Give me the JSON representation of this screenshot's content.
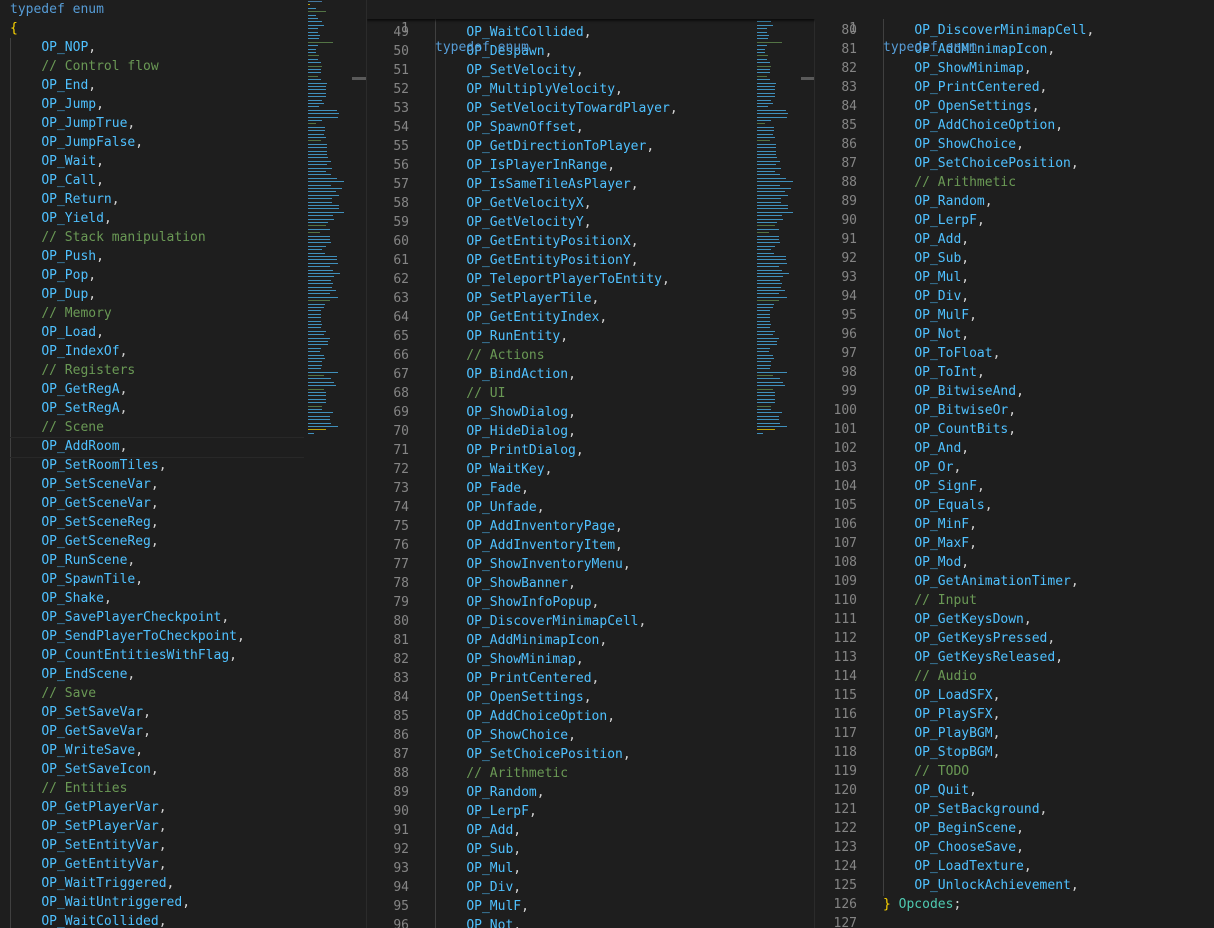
{
  "colors": {
    "keyword": "#569cd6",
    "comment": "#6a9955",
    "constant": "#4fc1ff",
    "brace": "#ffd700",
    "type": "#4ec9b0",
    "background": "#1e1e1e"
  },
  "pane1": {
    "lines": [
      [
        {
          "t": "typedef enum",
          "c": "key"
        }
      ],
      [
        {
          "t": "{",
          "c": "brace"
        }
      ],
      [
        {
          "t": "    "
        },
        {
          "t": "OP_NOP",
          "c": "const"
        },
        {
          "t": ",",
          "c": "punc"
        }
      ],
      [
        {
          "t": "    "
        },
        {
          "t": "// Control flow",
          "c": "cmt"
        }
      ],
      [
        {
          "t": "    "
        },
        {
          "t": "OP_End",
          "c": "const"
        },
        {
          "t": ",",
          "c": "punc"
        }
      ],
      [
        {
          "t": "    "
        },
        {
          "t": "OP_Jump",
          "c": "const"
        },
        {
          "t": ",",
          "c": "punc"
        }
      ],
      [
        {
          "t": "    "
        },
        {
          "t": "OP_JumpTrue",
          "c": "const"
        },
        {
          "t": ",",
          "c": "punc"
        }
      ],
      [
        {
          "t": "    "
        },
        {
          "t": "OP_JumpFalse",
          "c": "const"
        },
        {
          "t": ",",
          "c": "punc"
        }
      ],
      [
        {
          "t": "    "
        },
        {
          "t": "OP_Wait",
          "c": "const"
        },
        {
          "t": ",",
          "c": "punc"
        }
      ],
      [
        {
          "t": "    "
        },
        {
          "t": "OP_Call",
          "c": "const"
        },
        {
          "t": ",",
          "c": "punc"
        }
      ],
      [
        {
          "t": "    "
        },
        {
          "t": "OP_Return",
          "c": "const"
        },
        {
          "t": ",",
          "c": "punc"
        }
      ],
      [
        {
          "t": "    "
        },
        {
          "t": "OP_Yield",
          "c": "const"
        },
        {
          "t": ",",
          "c": "punc"
        }
      ],
      [
        {
          "t": "    "
        },
        {
          "t": "// Stack manipulation",
          "c": "cmt"
        }
      ],
      [
        {
          "t": "    "
        },
        {
          "t": "OP_Push",
          "c": "const"
        },
        {
          "t": ",",
          "c": "punc"
        }
      ],
      [
        {
          "t": "    "
        },
        {
          "t": "OP_Pop",
          "c": "const"
        },
        {
          "t": ",",
          "c": "punc"
        }
      ],
      [
        {
          "t": "    "
        },
        {
          "t": "OP_Dup",
          "c": "const"
        },
        {
          "t": ",",
          "c": "punc"
        }
      ],
      [
        {
          "t": "    "
        },
        {
          "t": "// Memory",
          "c": "cmt"
        }
      ],
      [
        {
          "t": "    "
        },
        {
          "t": "OP_Load",
          "c": "const"
        },
        {
          "t": ",",
          "c": "punc"
        }
      ],
      [
        {
          "t": "    "
        },
        {
          "t": "OP_IndexOf",
          "c": "const"
        },
        {
          "t": ",",
          "c": "punc"
        }
      ],
      [
        {
          "t": "    "
        },
        {
          "t": "// Registers",
          "c": "cmt"
        }
      ],
      [
        {
          "t": "    "
        },
        {
          "t": "OP_GetRegA",
          "c": "const"
        },
        {
          "t": ",",
          "c": "punc"
        }
      ],
      [
        {
          "t": "    "
        },
        {
          "t": "OP_SetRegA",
          "c": "const"
        },
        {
          "t": ",",
          "c": "punc"
        }
      ],
      [
        {
          "t": "    "
        },
        {
          "t": "// Scene",
          "c": "cmt"
        }
      ],
      [
        {
          "t": "    "
        },
        {
          "t": "OP_AddRoom",
          "c": "const"
        },
        {
          "t": ",",
          "c": "punc"
        }
      ],
      [
        {
          "t": "    "
        },
        {
          "t": "OP_SetRoomTiles",
          "c": "const"
        },
        {
          "t": ",",
          "c": "punc"
        }
      ],
      [
        {
          "t": "    "
        },
        {
          "t": "OP_SetSceneVar",
          "c": "const"
        },
        {
          "t": ",",
          "c": "punc"
        }
      ],
      [
        {
          "t": "    "
        },
        {
          "t": "OP_GetSceneVar",
          "c": "const"
        },
        {
          "t": ",",
          "c": "punc"
        }
      ],
      [
        {
          "t": "    "
        },
        {
          "t": "OP_SetSceneReg",
          "c": "const"
        },
        {
          "t": ",",
          "c": "punc"
        }
      ],
      [
        {
          "t": "    "
        },
        {
          "t": "OP_GetSceneReg",
          "c": "const"
        },
        {
          "t": ",",
          "c": "punc"
        }
      ],
      [
        {
          "t": "    "
        },
        {
          "t": "OP_RunScene",
          "c": "const"
        },
        {
          "t": ",",
          "c": "punc"
        }
      ],
      [
        {
          "t": "    "
        },
        {
          "t": "OP_SpawnTile",
          "c": "const"
        },
        {
          "t": ",",
          "c": "punc"
        }
      ],
      [
        {
          "t": "    "
        },
        {
          "t": "OP_Shake",
          "c": "const"
        },
        {
          "t": ",",
          "c": "punc"
        }
      ],
      [
        {
          "t": "    "
        },
        {
          "t": "OP_SavePlayerCheckpoint",
          "c": "const"
        },
        {
          "t": ",",
          "c": "punc"
        }
      ],
      [
        {
          "t": "    "
        },
        {
          "t": "OP_SendPlayerToCheckpoint",
          "c": "const"
        },
        {
          "t": ",",
          "c": "punc"
        }
      ],
      [
        {
          "t": "    "
        },
        {
          "t": "OP_CountEntitiesWithFlag",
          "c": "const"
        },
        {
          "t": ",",
          "c": "punc"
        }
      ],
      [
        {
          "t": "    "
        },
        {
          "t": "OP_EndScene",
          "c": "const"
        },
        {
          "t": ",",
          "c": "punc"
        }
      ],
      [
        {
          "t": "    "
        },
        {
          "t": "// Save",
          "c": "cmt"
        }
      ],
      [
        {
          "t": "    "
        },
        {
          "t": "OP_SetSaveVar",
          "c": "const"
        },
        {
          "t": ",",
          "c": "punc"
        }
      ],
      [
        {
          "t": "    "
        },
        {
          "t": "OP_GetSaveVar",
          "c": "const"
        },
        {
          "t": ",",
          "c": "punc"
        }
      ],
      [
        {
          "t": "    "
        },
        {
          "t": "OP_WriteSave",
          "c": "const"
        },
        {
          "t": ",",
          "c": "punc"
        }
      ],
      [
        {
          "t": "    "
        },
        {
          "t": "OP_SetSaveIcon",
          "c": "const"
        },
        {
          "t": ",",
          "c": "punc"
        }
      ],
      [
        {
          "t": "    "
        },
        {
          "t": "// Entities",
          "c": "cmt"
        }
      ],
      [
        {
          "t": "    "
        },
        {
          "t": "OP_GetPlayerVar",
          "c": "const"
        },
        {
          "t": ",",
          "c": "punc"
        }
      ],
      [
        {
          "t": "    "
        },
        {
          "t": "OP_SetPlayerVar",
          "c": "const"
        },
        {
          "t": ",",
          "c": "punc"
        }
      ],
      [
        {
          "t": "    "
        },
        {
          "t": "OP_SetEntityVar",
          "c": "const"
        },
        {
          "t": ",",
          "c": "punc"
        }
      ],
      [
        {
          "t": "    "
        },
        {
          "t": "OP_GetEntityVar",
          "c": "const"
        },
        {
          "t": ",",
          "c": "punc"
        }
      ],
      [
        {
          "t": "    "
        },
        {
          "t": "OP_WaitTriggered",
          "c": "const"
        },
        {
          "t": ",",
          "c": "punc"
        }
      ],
      [
        {
          "t": "    "
        },
        {
          "t": "OP_WaitUntriggered",
          "c": "const"
        },
        {
          "t": ",",
          "c": "punc"
        }
      ],
      [
        {
          "t": "    "
        },
        {
          "t": "OP_WaitCollided",
          "c": "const"
        },
        {
          "t": ",",
          "c": "punc"
        }
      ]
    ]
  },
  "pane2": {
    "sticky": {
      "num": "1",
      "text": "typedef enum"
    },
    "lines": [
      {
        "n": "49",
        "t": "OP_WaitCollided"
      },
      {
        "n": "50",
        "t": "OP_Despawn"
      },
      {
        "n": "51",
        "t": "OP_SetVelocity"
      },
      {
        "n": "52",
        "t": "OP_MultiplyVelocity"
      },
      {
        "n": "53",
        "t": "OP_SetVelocityTowardPlayer"
      },
      {
        "n": "54",
        "t": "OP_SpawnOffset"
      },
      {
        "n": "55",
        "t": "OP_GetDirectionToPlayer"
      },
      {
        "n": "56",
        "t": "OP_IsPlayerInRange"
      },
      {
        "n": "57",
        "t": "OP_IsSameTileAsPlayer"
      },
      {
        "n": "58",
        "t": "OP_GetVelocityX"
      },
      {
        "n": "59",
        "t": "OP_GetVelocityY"
      },
      {
        "n": "60",
        "t": "OP_GetEntityPositionX"
      },
      {
        "n": "61",
        "t": "OP_GetEntityPositionY"
      },
      {
        "n": "62",
        "t": "OP_TeleportPlayerToEntity"
      },
      {
        "n": "63",
        "t": "OP_SetPlayerTile"
      },
      {
        "n": "64",
        "t": "OP_GetEntityIndex"
      },
      {
        "n": "65",
        "t": "OP_RunEntity"
      },
      {
        "n": "66",
        "t": "// Actions",
        "c": "cmt"
      },
      {
        "n": "67",
        "t": "OP_BindAction"
      },
      {
        "n": "68",
        "t": "// UI",
        "c": "cmt"
      },
      {
        "n": "69",
        "t": "OP_ShowDialog"
      },
      {
        "n": "70",
        "t": "OP_HideDialog"
      },
      {
        "n": "71",
        "t": "OP_PrintDialog"
      },
      {
        "n": "72",
        "t": "OP_WaitKey"
      },
      {
        "n": "73",
        "t": "OP_Fade"
      },
      {
        "n": "74",
        "t": "OP_Unfade"
      },
      {
        "n": "75",
        "t": "OP_AddInventoryPage"
      },
      {
        "n": "76",
        "t": "OP_AddInventoryItem"
      },
      {
        "n": "77",
        "t": "OP_ShowInventoryMenu"
      },
      {
        "n": "78",
        "t": "OP_ShowBanner"
      },
      {
        "n": "79",
        "t": "OP_ShowInfoPopup"
      },
      {
        "n": "80",
        "t": "OP_DiscoverMinimapCell"
      },
      {
        "n": "81",
        "t": "OP_AddMinimapIcon"
      },
      {
        "n": "82",
        "t": "OP_ShowMinimap"
      },
      {
        "n": "83",
        "t": "OP_PrintCentered"
      },
      {
        "n": "84",
        "t": "OP_OpenSettings"
      },
      {
        "n": "85",
        "t": "OP_AddChoiceOption"
      },
      {
        "n": "86",
        "t": "OP_ShowChoice"
      },
      {
        "n": "87",
        "t": "OP_SetChoicePosition"
      },
      {
        "n": "88",
        "t": "// Arithmetic",
        "c": "cmt"
      },
      {
        "n": "89",
        "t": "OP_Random"
      },
      {
        "n": "90",
        "t": "OP_LerpF"
      },
      {
        "n": "91",
        "t": "OP_Add"
      },
      {
        "n": "92",
        "t": "OP_Sub"
      },
      {
        "n": "93",
        "t": "OP_Mul"
      },
      {
        "n": "94",
        "t": "OP_Div"
      },
      {
        "n": "95",
        "t": "OP_MulF"
      },
      {
        "n": "96",
        "t": "OP_Not"
      }
    ]
  },
  "pane3": {
    "sticky": {
      "num": "1",
      "text": "typedef enum"
    },
    "lines": [
      {
        "n": "80",
        "t": "OP_DiscoverMinimapCell"
      },
      {
        "n": "81",
        "t": "OP_AddMinimapIcon"
      },
      {
        "n": "82",
        "t": "OP_ShowMinimap"
      },
      {
        "n": "83",
        "t": "OP_PrintCentered"
      },
      {
        "n": "84",
        "t": "OP_OpenSettings"
      },
      {
        "n": "85",
        "t": "OP_AddChoiceOption"
      },
      {
        "n": "86",
        "t": "OP_ShowChoice"
      },
      {
        "n": "87",
        "t": "OP_SetChoicePosition"
      },
      {
        "n": "88",
        "t": "// Arithmetic",
        "c": "cmt"
      },
      {
        "n": "89",
        "t": "OP_Random"
      },
      {
        "n": "90",
        "t": "OP_LerpF"
      },
      {
        "n": "91",
        "t": "OP_Add"
      },
      {
        "n": "92",
        "t": "OP_Sub"
      },
      {
        "n": "93",
        "t": "OP_Mul"
      },
      {
        "n": "94",
        "t": "OP_Div"
      },
      {
        "n": "95",
        "t": "OP_MulF"
      },
      {
        "n": "96",
        "t": "OP_Not"
      },
      {
        "n": "97",
        "t": "OP_ToFloat"
      },
      {
        "n": "98",
        "t": "OP_ToInt"
      },
      {
        "n": "99",
        "t": "OP_BitwiseAnd"
      },
      {
        "n": "100",
        "t": "OP_BitwiseOr"
      },
      {
        "n": "101",
        "t": "OP_CountBits"
      },
      {
        "n": "102",
        "t": "OP_And"
      },
      {
        "n": "103",
        "t": "OP_Or"
      },
      {
        "n": "104",
        "t": "OP_SignF"
      },
      {
        "n": "105",
        "t": "OP_Equals"
      },
      {
        "n": "106",
        "t": "OP_MinF"
      },
      {
        "n": "107",
        "t": "OP_MaxF"
      },
      {
        "n": "108",
        "t": "OP_Mod"
      },
      {
        "n": "109",
        "t": "OP_GetAnimationTimer"
      },
      {
        "n": "110",
        "t": "// Input",
        "c": "cmt"
      },
      {
        "n": "111",
        "t": "OP_GetKeysDown"
      },
      {
        "n": "112",
        "t": "OP_GetKeysPressed"
      },
      {
        "n": "113",
        "t": "OP_GetKeysReleased"
      },
      {
        "n": "114",
        "t": "// Audio",
        "c": "cmt"
      },
      {
        "n": "115",
        "t": "OP_LoadSFX"
      },
      {
        "n": "116",
        "t": "OP_PlaySFX"
      },
      {
        "n": "117",
        "t": "OP_PlayBGM"
      },
      {
        "n": "118",
        "t": "OP_StopBGM"
      },
      {
        "n": "119",
        "t": "// TODO",
        "c": "cmt"
      },
      {
        "n": "120",
        "t": "OP_Quit"
      },
      {
        "n": "121",
        "t": "OP_SetBackground"
      },
      {
        "n": "122",
        "t": "OP_BeginScene"
      },
      {
        "n": "123",
        "t": "OP_ChooseSave"
      },
      {
        "n": "124",
        "t": "OP_LoadTexture"
      },
      {
        "n": "125",
        "t": "OP_UnlockAchievement"
      },
      {
        "n": "126",
        "t": "} Opcodes;",
        "c": "close"
      },
      {
        "n": "127",
        "t": ""
      }
    ]
  }
}
